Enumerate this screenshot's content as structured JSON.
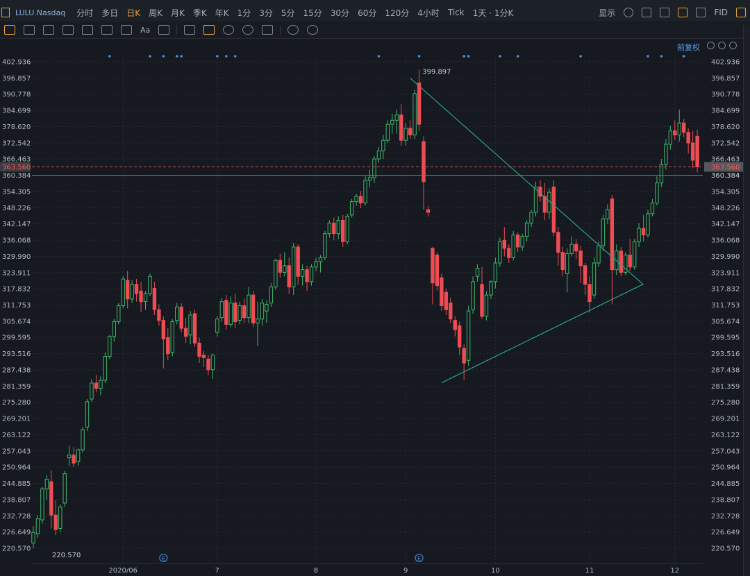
{
  "toolbar": {
    "symbol": "LULU.Nasdaq",
    "periods": [
      {
        "label": "分时",
        "active": false
      },
      {
        "label": "多日",
        "active": false
      },
      {
        "label": "日K",
        "active": true
      },
      {
        "label": "周K",
        "active": false
      },
      {
        "label": "月K",
        "active": false
      },
      {
        "label": "季K",
        "active": false
      },
      {
        "label": "年K",
        "active": false
      },
      {
        "label": "1分",
        "active": false
      },
      {
        "label": "3分",
        "active": false
      },
      {
        "label": "5分",
        "active": false
      },
      {
        "label": "15分",
        "active": false
      },
      {
        "label": "30分",
        "active": false
      },
      {
        "label": "60分",
        "active": false
      },
      {
        "label": "120分",
        "active": false
      },
      {
        "label": "4小时",
        "active": false
      },
      {
        "label": "Tick",
        "active": false
      },
      {
        "label": "1天 · 1分K",
        "active": false
      }
    ],
    "display_label": "显示",
    "fid_label": "FID",
    "text_tool_label": "Aa"
  },
  "fuquan_label": "前复权",
  "colors": {
    "up": "#3fb86a",
    "down": "#ee4d54",
    "trendline": "#2aa389",
    "price_line": "#e04a50",
    "marker_dot": "#4a90e2",
    "accent": "#e9a23b"
  },
  "chart_data": {
    "type": "candlestick",
    "title": "LULU.Nasdaq",
    "yticks": [
      "402.936",
      "396.857",
      "390.778",
      "384.699",
      "378.620",
      "372.542",
      "366.463",
      "360.384",
      "354.305",
      "348.226",
      "342.147",
      "336.068",
      "329.990",
      "323.911",
      "317.832",
      "311.753",
      "305.674",
      "299.595",
      "293.516",
      "287.438",
      "281.359",
      "275.280",
      "269.201",
      "263.122",
      "257.043",
      "250.964",
      "244.885",
      "238.807",
      "232.728",
      "226.649",
      "220.570"
    ],
    "ylim": [
      220.57,
      402.936
    ],
    "xticks": [
      {
        "label": "2020/06",
        "index": 20
      },
      {
        "label": "7",
        "index": 41
      },
      {
        "label": "8",
        "index": 63
      },
      {
        "label": "9",
        "index": 83
      },
      {
        "label": "10",
        "index": 103
      },
      {
        "label": "11",
        "index": 124
      },
      {
        "label": "12",
        "index": 143
      }
    ],
    "bars_count": 150,
    "current_price": {
      "label": "363.560",
      "value": 363.56
    },
    "horizontal_line": {
      "label": "360.384",
      "value": 360.384
    },
    "max_label": {
      "text": "399.897",
      "value": 399.897,
      "index": 83
    },
    "min_label": {
      "text": "220.570",
      "value": 220.57,
      "index": 1
    },
    "trendlines": [
      {
        "from": {
          "index": 84,
          "value": 396.8
        },
        "to": {
          "index": 136,
          "value": 319.4
        }
      },
      {
        "from": {
          "index": 91,
          "value": 282.6
        },
        "to": {
          "index": 136,
          "value": 319.6
        }
      }
    ],
    "event_markers": [
      {
        "index": 29,
        "label": "E"
      },
      {
        "index": 86,
        "label": "E"
      }
    ],
    "dot_markers": [
      17,
      26,
      29,
      32,
      33,
      41,
      43,
      45,
      77,
      86,
      96,
      97,
      104,
      108,
      122,
      137,
      140,
      145
    ],
    "candles": [
      {
        "o": 222.5,
        "h": 228.8,
        "l": 220.6,
        "c": 226.5
      },
      {
        "o": 226.0,
        "h": 233.0,
        "l": 224.5,
        "c": 231.6
      },
      {
        "o": 231.2,
        "h": 243.5,
        "l": 229.8,
        "c": 242.8
      },
      {
        "o": 242.8,
        "h": 248.0,
        "l": 238.7,
        "c": 246.4
      },
      {
        "o": 245.5,
        "h": 249.8,
        "l": 228.0,
        "c": 233.0
      },
      {
        "o": 233.0,
        "h": 238.5,
        "l": 225.5,
        "c": 227.5
      },
      {
        "o": 228.0,
        "h": 237.0,
        "l": 226.5,
        "c": 236.0
      },
      {
        "o": 237.5,
        "h": 249.5,
        "l": 236.0,
        "c": 248.5
      },
      {
        "o": 254.5,
        "h": 259.0,
        "l": 251.5,
        "c": 255.5
      },
      {
        "o": 255.5,
        "h": 258.5,
        "l": 251.0,
        "c": 252.5
      },
      {
        "o": 253.0,
        "h": 258.0,
        "l": 251.5,
        "c": 257.5
      },
      {
        "o": 257.5,
        "h": 266.0,
        "l": 256.5,
        "c": 265.0
      },
      {
        "o": 266.0,
        "h": 276.5,
        "l": 264.5,
        "c": 275.5
      },
      {
        "o": 276.5,
        "h": 284.0,
        "l": 275.5,
        "c": 282.5
      },
      {
        "o": 282.5,
        "h": 285.5,
        "l": 279.0,
        "c": 280.5
      },
      {
        "o": 280.5,
        "h": 285.0,
        "l": 278.0,
        "c": 283.5
      },
      {
        "o": 283.5,
        "h": 294.0,
        "l": 282.5,
        "c": 292.5
      },
      {
        "o": 292.5,
        "h": 300.5,
        "l": 291.5,
        "c": 300.0
      },
      {
        "o": 300.0,
        "h": 306.5,
        "l": 298.0,
        "c": 305.5
      },
      {
        "o": 305.5,
        "h": 312.5,
        "l": 304.5,
        "c": 311.5
      },
      {
        "o": 311.5,
        "h": 322.5,
        "l": 310.5,
        "c": 321.5
      },
      {
        "o": 321.0,
        "h": 324.5,
        "l": 310.5,
        "c": 314.0
      },
      {
        "o": 314.0,
        "h": 321.0,
        "l": 312.5,
        "c": 319.5
      },
      {
        "o": 319.5,
        "h": 321.5,
        "l": 313.0,
        "c": 316.0
      },
      {
        "o": 317.0,
        "h": 320.5,
        "l": 309.0,
        "c": 313.0
      },
      {
        "o": 313.0,
        "h": 317.0,
        "l": 310.0,
        "c": 316.0
      },
      {
        "o": 316.0,
        "h": 323.5,
        "l": 315.0,
        "c": 322.5
      },
      {
        "o": 318.0,
        "h": 320.5,
        "l": 308.0,
        "c": 310.0
      },
      {
        "o": 310.0,
        "h": 312.0,
        "l": 304.0,
        "c": 306.0
      },
      {
        "o": 306.0,
        "h": 307.5,
        "l": 288.0,
        "c": 299.0
      },
      {
        "o": 299.5,
        "h": 303.0,
        "l": 291.0,
        "c": 293.5
      },
      {
        "o": 294.0,
        "h": 306.5,
        "l": 292.5,
        "c": 305.5
      },
      {
        "o": 306.0,
        "h": 312.5,
        "l": 304.5,
        "c": 311.0
      },
      {
        "o": 311.0,
        "h": 312.5,
        "l": 301.5,
        "c": 303.0
      },
      {
        "o": 303.0,
        "h": 307.0,
        "l": 297.5,
        "c": 300.0
      },
      {
        "o": 300.5,
        "h": 309.5,
        "l": 297.0,
        "c": 308.0
      },
      {
        "o": 308.5,
        "h": 310.0,
        "l": 296.0,
        "c": 297.5
      },
      {
        "o": 297.5,
        "h": 299.5,
        "l": 290.0,
        "c": 292.5
      },
      {
        "o": 293.0,
        "h": 294.5,
        "l": 288.5,
        "c": 292.0
      },
      {
        "o": 291.5,
        "h": 293.0,
        "l": 285.5,
        "c": 287.5
      },
      {
        "o": 287.5,
        "h": 293.5,
        "l": 284.0,
        "c": 293.0
      },
      {
        "o": 301.5,
        "h": 307.5,
        "l": 300.0,
        "c": 306.5
      },
      {
        "o": 307.0,
        "h": 314.5,
        "l": 305.5,
        "c": 313.0
      },
      {
        "o": 313.5,
        "h": 315.5,
        "l": 302.5,
        "c": 304.5
      },
      {
        "o": 304.5,
        "h": 315.0,
        "l": 303.5,
        "c": 312.5
      },
      {
        "o": 312.5,
        "h": 316.0,
        "l": 303.0,
        "c": 305.5
      },
      {
        "o": 306.0,
        "h": 313.0,
        "l": 304.5,
        "c": 311.5
      },
      {
        "o": 311.5,
        "h": 314.0,
        "l": 305.0,
        "c": 307.0
      },
      {
        "o": 307.0,
        "h": 318.5,
        "l": 305.0,
        "c": 315.5
      },
      {
        "o": 315.5,
        "h": 317.0,
        "l": 303.5,
        "c": 305.0
      },
      {
        "o": 305.0,
        "h": 313.0,
        "l": 296.5,
        "c": 306.5
      },
      {
        "o": 306.5,
        "h": 314.0,
        "l": 304.0,
        "c": 312.5
      },
      {
        "o": 309.5,
        "h": 313.5,
        "l": 305.0,
        "c": 312.0
      },
      {
        "o": 312.5,
        "h": 320.0,
        "l": 311.0,
        "c": 318.5
      },
      {
        "o": 318.5,
        "h": 329.0,
        "l": 317.5,
        "c": 328.5
      },
      {
        "o": 328.5,
        "h": 331.0,
        "l": 322.0,
        "c": 324.0
      },
      {
        "o": 324.0,
        "h": 331.5,
        "l": 322.5,
        "c": 326.5
      },
      {
        "o": 326.5,
        "h": 329.5,
        "l": 316.0,
        "c": 318.5
      },
      {
        "o": 318.5,
        "h": 335.0,
        "l": 315.5,
        "c": 333.5
      },
      {
        "o": 333.5,
        "h": 334.5,
        "l": 319.5,
        "c": 322.5
      },
      {
        "o": 322.5,
        "h": 327.0,
        "l": 319.0,
        "c": 325.0
      },
      {
        "o": 325.0,
        "h": 326.5,
        "l": 317.0,
        "c": 320.5
      },
      {
        "o": 320.5,
        "h": 327.0,
        "l": 319.0,
        "c": 326.0
      },
      {
        "o": 326.0,
        "h": 329.5,
        "l": 324.5,
        "c": 328.0
      },
      {
        "o": 328.0,
        "h": 330.5,
        "l": 324.0,
        "c": 329.5
      },
      {
        "o": 329.5,
        "h": 339.5,
        "l": 328.5,
        "c": 338.5
      },
      {
        "o": 338.5,
        "h": 343.5,
        "l": 337.0,
        "c": 342.5
      },
      {
        "o": 342.5,
        "h": 344.5,
        "l": 336.0,
        "c": 338.5
      },
      {
        "o": 338.5,
        "h": 345.0,
        "l": 336.5,
        "c": 343.5
      },
      {
        "o": 343.5,
        "h": 345.5,
        "l": 333.5,
        "c": 335.5
      },
      {
        "o": 335.5,
        "h": 346.0,
        "l": 334.5,
        "c": 345.0
      },
      {
        "o": 345.5,
        "h": 351.5,
        "l": 344.5,
        "c": 350.5
      },
      {
        "o": 350.5,
        "h": 353.5,
        "l": 349.0,
        "c": 352.5
      },
      {
        "o": 352.5,
        "h": 354.5,
        "l": 348.0,
        "c": 350.0
      },
      {
        "o": 350.0,
        "h": 360.0,
        "l": 349.0,
        "c": 358.5
      },
      {
        "o": 358.5,
        "h": 362.5,
        "l": 356.0,
        "c": 359.5
      },
      {
        "o": 359.5,
        "h": 367.5,
        "l": 357.5,
        "c": 366.5
      },
      {
        "o": 366.5,
        "h": 371.0,
        "l": 365.0,
        "c": 369.5
      },
      {
        "o": 369.5,
        "h": 375.5,
        "l": 366.5,
        "c": 373.5
      },
      {
        "o": 373.5,
        "h": 381.0,
        "l": 372.5,
        "c": 379.5
      },
      {
        "o": 379.5,
        "h": 383.5,
        "l": 376.0,
        "c": 381.0
      },
      {
        "o": 381.0,
        "h": 385.0,
        "l": 376.0,
        "c": 383.0
      },
      {
        "o": 383.0,
        "h": 387.0,
        "l": 371.5,
        "c": 373.5
      },
      {
        "o": 373.5,
        "h": 380.0,
        "l": 371.5,
        "c": 378.0
      },
      {
        "o": 378.0,
        "h": 381.0,
        "l": 374.0,
        "c": 375.5
      },
      {
        "o": 375.5,
        "h": 392.5,
        "l": 374.0,
        "c": 391.0
      },
      {
        "o": 395.0,
        "h": 399.9,
        "l": 377.0,
        "c": 379.5
      },
      {
        "o": 373.0,
        "h": 375.0,
        "l": 347.5,
        "c": 358.0
      },
      {
        "o": 347.5,
        "h": 349.0,
        "l": 345.0,
        "c": 346.5
      },
      {
        "o": 333.0,
        "h": 333.5,
        "l": 312.0,
        "c": 320.0
      },
      {
        "o": 330.5,
        "h": 331.5,
        "l": 317.0,
        "c": 319.0
      },
      {
        "o": 322.0,
        "h": 323.5,
        "l": 309.5,
        "c": 311.5
      },
      {
        "o": 316.5,
        "h": 318.0,
        "l": 308.0,
        "c": 310.0
      },
      {
        "o": 312.5,
        "h": 314.5,
        "l": 305.0,
        "c": 306.5
      },
      {
        "o": 306.0,
        "h": 307.5,
        "l": 300.0,
        "c": 302.5
      },
      {
        "o": 304.0,
        "h": 305.5,
        "l": 293.0,
        "c": 296.0
      },
      {
        "o": 295.5,
        "h": 297.0,
        "l": 283.5,
        "c": 290.0
      },
      {
        "o": 291.0,
        "h": 311.5,
        "l": 289.0,
        "c": 309.5
      },
      {
        "o": 310.0,
        "h": 322.5,
        "l": 308.5,
        "c": 320.5
      },
      {
        "o": 322.5,
        "h": 327.0,
        "l": 320.5,
        "c": 325.5
      },
      {
        "o": 319.5,
        "h": 326.0,
        "l": 306.5,
        "c": 307.5
      },
      {
        "o": 307.5,
        "h": 317.0,
        "l": 306.0,
        "c": 315.5
      },
      {
        "o": 315.5,
        "h": 321.0,
        "l": 314.0,
        "c": 320.5
      },
      {
        "o": 320.5,
        "h": 329.5,
        "l": 318.0,
        "c": 327.5
      },
      {
        "o": 327.5,
        "h": 337.0,
        "l": 326.0,
        "c": 335.5
      },
      {
        "o": 336.0,
        "h": 341.0,
        "l": 330.0,
        "c": 333.0
      },
      {
        "o": 333.0,
        "h": 334.5,
        "l": 327.5,
        "c": 329.5
      },
      {
        "o": 329.5,
        "h": 339.5,
        "l": 328.5,
        "c": 338.0
      },
      {
        "o": 338.0,
        "h": 339.0,
        "l": 331.5,
        "c": 333.5
      },
      {
        "o": 333.5,
        "h": 338.5,
        "l": 332.0,
        "c": 337.5
      },
      {
        "o": 337.5,
        "h": 343.5,
        "l": 335.5,
        "c": 342.5
      },
      {
        "o": 342.5,
        "h": 347.5,
        "l": 341.0,
        "c": 346.5
      },
      {
        "o": 346.5,
        "h": 358.0,
        "l": 345.0,
        "c": 356.0
      },
      {
        "o": 356.0,
        "h": 358.5,
        "l": 350.5,
        "c": 352.5
      },
      {
        "o": 352.5,
        "h": 357.5,
        "l": 343.5,
        "c": 346.5
      },
      {
        "o": 346.5,
        "h": 355.5,
        "l": 344.0,
        "c": 354.0
      },
      {
        "o": 356.0,
        "h": 358.5,
        "l": 337.5,
        "c": 339.0
      },
      {
        "o": 339.0,
        "h": 341.0,
        "l": 326.5,
        "c": 331.5
      },
      {
        "o": 331.5,
        "h": 333.5,
        "l": 322.5,
        "c": 325.0
      },
      {
        "o": 323.5,
        "h": 333.0,
        "l": 316.5,
        "c": 331.0
      },
      {
        "o": 331.0,
        "h": 337.5,
        "l": 330.0,
        "c": 334.5
      },
      {
        "o": 334.5,
        "h": 336.5,
        "l": 329.0,
        "c": 332.0
      },
      {
        "o": 332.0,
        "h": 334.0,
        "l": 320.0,
        "c": 326.5
      },
      {
        "o": 326.5,
        "h": 327.5,
        "l": 315.5,
        "c": 319.5
      },
      {
        "o": 319.5,
        "h": 322.5,
        "l": 309.0,
        "c": 313.0
      },
      {
        "o": 315.5,
        "h": 329.5,
        "l": 314.0,
        "c": 327.5
      },
      {
        "o": 327.5,
        "h": 335.5,
        "l": 326.0,
        "c": 334.0
      },
      {
        "o": 334.0,
        "h": 345.5,
        "l": 332.0,
        "c": 344.0
      },
      {
        "o": 344.0,
        "h": 349.5,
        "l": 342.0,
        "c": 347.5
      },
      {
        "o": 351.5,
        "h": 353.0,
        "l": 312.0,
        "c": 325.0
      },
      {
        "o": 325.0,
        "h": 334.5,
        "l": 323.0,
        "c": 332.0
      },
      {
        "o": 332.0,
        "h": 333.5,
        "l": 322.5,
        "c": 324.0
      },
      {
        "o": 324.0,
        "h": 331.5,
        "l": 323.0,
        "c": 330.5
      },
      {
        "o": 330.5,
        "h": 336.5,
        "l": 324.5,
        "c": 326.0
      },
      {
        "o": 326.0,
        "h": 336.5,
        "l": 325.0,
        "c": 335.5
      },
      {
        "o": 335.5,
        "h": 342.5,
        "l": 333.5,
        "c": 340.5
      },
      {
        "o": 340.5,
        "h": 345.5,
        "l": 335.5,
        "c": 338.0
      },
      {
        "o": 338.0,
        "h": 347.5,
        "l": 337.0,
        "c": 346.0
      },
      {
        "o": 346.0,
        "h": 351.5,
        "l": 345.0,
        "c": 350.0
      },
      {
        "o": 350.0,
        "h": 360.0,
        "l": 349.0,
        "c": 357.5
      },
      {
        "o": 357.5,
        "h": 366.5,
        "l": 356.0,
        "c": 364.5
      },
      {
        "o": 364.5,
        "h": 374.0,
        "l": 362.5,
        "c": 372.0
      },
      {
        "o": 372.0,
        "h": 379.0,
        "l": 370.0,
        "c": 377.0
      },
      {
        "o": 377.0,
        "h": 381.0,
        "l": 373.5,
        "c": 375.5
      },
      {
        "o": 375.5,
        "h": 385.0,
        "l": 373.0,
        "c": 380.0
      },
      {
        "o": 380.0,
        "h": 381.5,
        "l": 374.5,
        "c": 376.5
      },
      {
        "o": 376.5,
        "h": 378.0,
        "l": 368.5,
        "c": 372.5
      },
      {
        "o": 372.5,
        "h": 377.0,
        "l": 363.0,
        "c": 366.0
      },
      {
        "o": 375.0,
        "h": 377.5,
        "l": 361.5,
        "c": 363.56
      }
    ]
  }
}
